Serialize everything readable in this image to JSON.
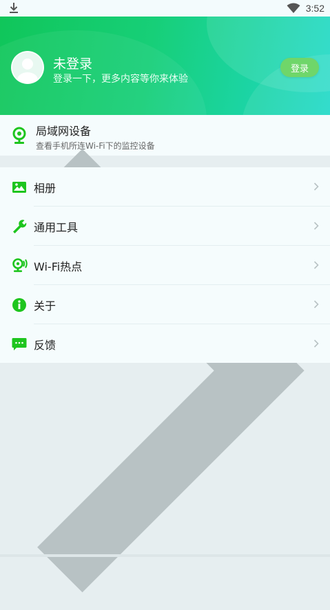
{
  "status_bar": {
    "time": "3:52",
    "left_icon": "download-icon",
    "wifi_icon": "wifi-icon"
  },
  "profile": {
    "name": "未登录",
    "subtitle": "登录一下，更多内容等你来体验",
    "login_button": "登录",
    "avatar_icon": "avatar-icon"
  },
  "lan": {
    "title": "局域网设备",
    "subtitle": "查看手机所连Wi-Fi下的监控设备",
    "icon": "camera-icon"
  },
  "menu": [
    {
      "label": "相册",
      "icon": "image-icon"
    },
    {
      "label": "通用工具",
      "icon": "wrench-icon"
    },
    {
      "label": "Wi-Fi热点",
      "icon": "hotspot-icon"
    },
    {
      "label": "关于",
      "icon": "info-icon"
    },
    {
      "label": "反馈",
      "icon": "feedback-icon"
    }
  ],
  "colors": {
    "accent_green": "#1ec51e",
    "header_gradient_start": "#10c65a",
    "header_gradient_end": "#1fd9c8",
    "login_button_bg": "#6fd66a"
  }
}
